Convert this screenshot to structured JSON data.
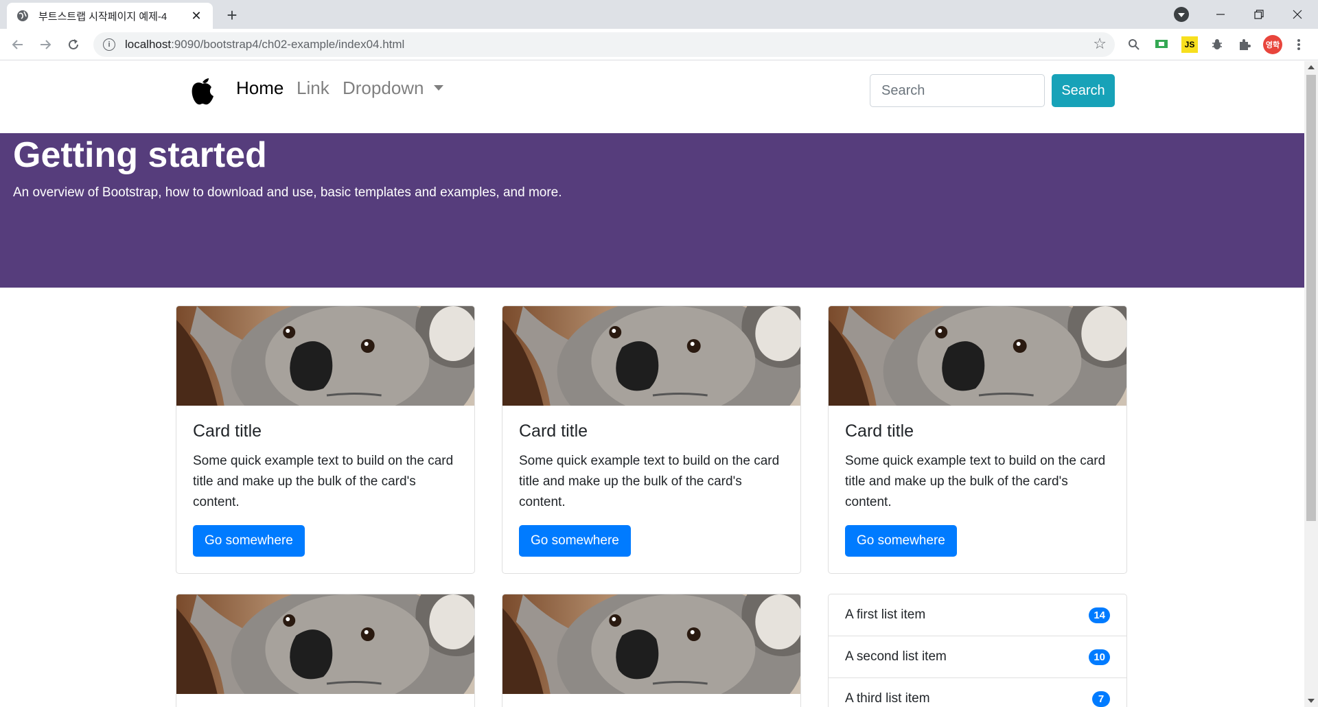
{
  "browser": {
    "tab_title": "부트스트랩 시작페이지 예제-4",
    "url_host": "localhost",
    "url_path": ":9090/bootstrap4/ch02-example/index04.html",
    "profile_label": "영학",
    "ext_js_label": "JS"
  },
  "navbar": {
    "links": [
      {
        "label": "Home"
      },
      {
        "label": "Link"
      },
      {
        "label": "Dropdown"
      }
    ],
    "search_placeholder": "Search",
    "search_button": "Search"
  },
  "jumbotron": {
    "title": "Getting started",
    "lead": "An overview of Bootstrap, how to download and use, basic templates and examples, and more."
  },
  "cards": [
    {
      "title": "Card title",
      "text": "Some quick example text to build on the card title and make up the bulk of the card's content.",
      "button": "Go somewhere"
    },
    {
      "title": "Card title",
      "text": "Some quick example text to build on the card title and make up the bulk of the card's content.",
      "button": "Go somewhere"
    },
    {
      "title": "Card title",
      "text": "Some quick example text to build on the card title and make up the bulk of the card's content.",
      "button": "Go somewhere"
    }
  ],
  "list_group": [
    {
      "label": "A first list item",
      "badge": "14"
    },
    {
      "label": "A second list item",
      "badge": "10"
    },
    {
      "label": "A third list item",
      "badge": "7"
    }
  ],
  "colors": {
    "jumbotron_bg": "#563d7c",
    "primary": "#007bff",
    "info": "#17a2b8"
  }
}
